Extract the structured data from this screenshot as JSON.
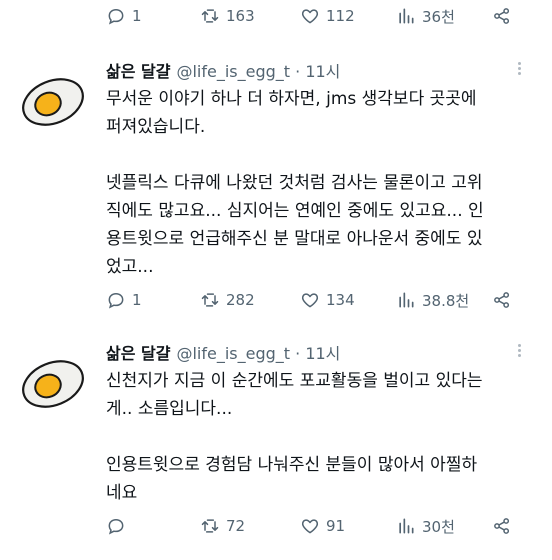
{
  "tweets": [
    {
      "stats": {
        "replies": "1",
        "retweets": "163",
        "likes": "112",
        "views": "36천"
      }
    },
    {
      "author": {
        "name": "삶은 달걀",
        "handle": "@life_is_egg_t",
        "separator": "·",
        "time": "11시"
      },
      "paragraphs": [
        "무서운 이야기 하나 더 하자면, jms 생각보다 곳곳에\n퍼져있습니다.",
        "넷플릭스 다큐에 나왔던 것처럼 검사는 물론이고 고위\n직에도 많고요... 심지어는 연예인 중에도 있고요... 인\n용트윗으로 언급해주신 분 말대로 아나운서 중에도 있\n었고..."
      ],
      "stats": {
        "replies": "1",
        "retweets": "282",
        "likes": "134",
        "views": "38.8천"
      }
    },
    {
      "author": {
        "name": "삶은 달걀",
        "handle": "@life_is_egg_t",
        "separator": "·",
        "time": "11시"
      },
      "paragraphs": [
        "신천지가 지금 이 순간에도 포교활동을 벌이고 있다는\n게.. 소름입니다...",
        "인용트윗으로 경험담 나눠주신 분들이 많아서 아찔하\n네요"
      ],
      "stats": {
        "replies": "",
        "retweets": "72",
        "likes": "91",
        "views": "30천"
      }
    }
  ],
  "icons": {
    "reply": "reply-icon",
    "retweet": "retweet-icon",
    "like": "heart-icon",
    "views": "views-icon",
    "share": "share-icon",
    "more": "more-icon",
    "avatar": "boiled-egg-icon"
  },
  "colors": {
    "text": "#0f1419",
    "muted": "#536471",
    "retweet": "#536471"
  }
}
